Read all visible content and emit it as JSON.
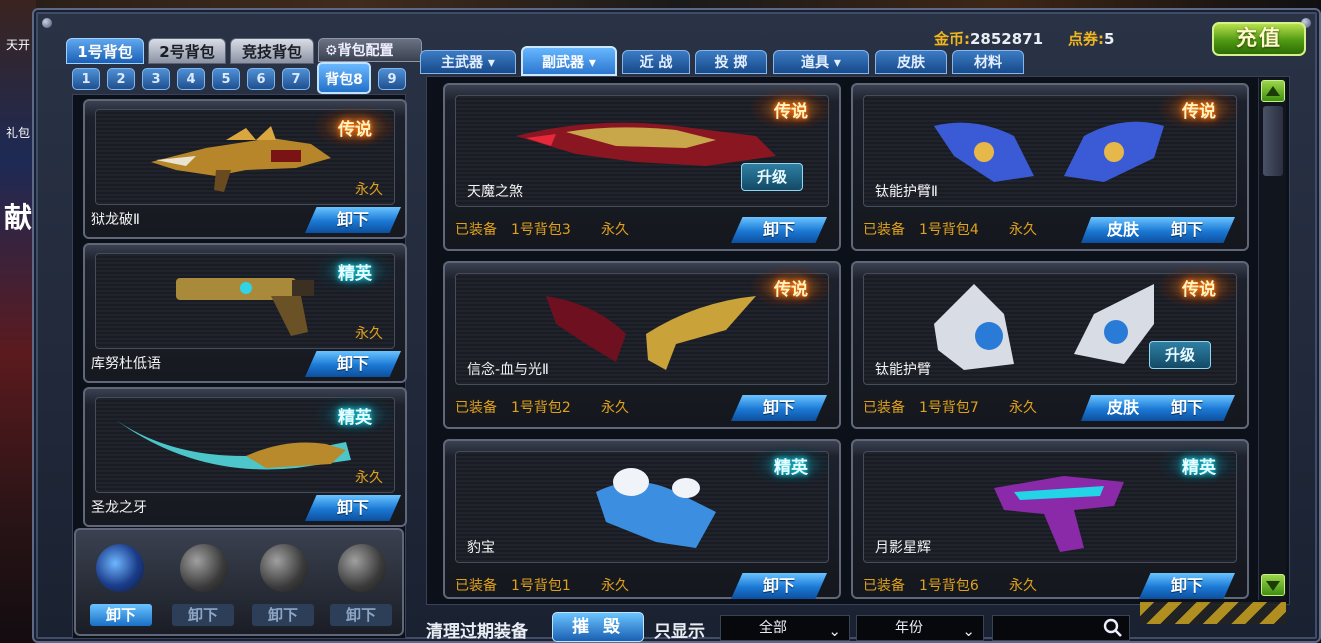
{
  "background": {
    "left_fragments": [
      "天开",
      "礼包",
      "献"
    ]
  },
  "header": {
    "gold_label": "金币:",
    "gold_value": "2852871",
    "points_label": "点券:",
    "points_value": "5",
    "recharge_label": "充值"
  },
  "bag_tabs": [
    {
      "label": "1号背包",
      "active": true
    },
    {
      "label": "2号背包",
      "active": false
    },
    {
      "label": "竞技背包",
      "active": false
    }
  ],
  "bag_config_label": "背包配置",
  "bag_numbers": [
    "1",
    "2",
    "3",
    "4",
    "5",
    "6",
    "7",
    "背包8",
    "9"
  ],
  "active_bag_number": "背包8",
  "equipped": [
    {
      "name": "狱龙破Ⅱ",
      "rarity": "传说",
      "duration": "永久",
      "button": "卸下"
    },
    {
      "name": "库努杜低语",
      "rarity": "精英",
      "duration": "永久",
      "button": "卸下"
    },
    {
      "name": "圣龙之牙",
      "rarity": "精英",
      "duration": "永久",
      "button": "卸下"
    }
  ],
  "grenade_slot": {
    "buttons": [
      "卸下",
      "卸下",
      "卸下",
      "卸下"
    ]
  },
  "weapon_tabs": [
    "主武器",
    "副武器",
    "近 战",
    "投 掷",
    "道具",
    "皮肤",
    "材料"
  ],
  "active_weapon_tab": "副武器",
  "items": [
    {
      "name": "天魔之煞",
      "rarity": "传说",
      "status": "已装备",
      "bag": "1号背包3",
      "duration": "永久",
      "upgrade": "升级",
      "skin": "",
      "button": "卸下"
    },
    {
      "name": "钛能护臂Ⅱ",
      "rarity": "传说",
      "status": "已装备",
      "bag": "1号背包4",
      "duration": "永久",
      "upgrade": "",
      "skin": "皮肤",
      "button": "卸下"
    },
    {
      "name": "信念-血与光Ⅱ",
      "rarity": "传说",
      "status": "已装备",
      "bag": "1号背包2",
      "duration": "永久",
      "upgrade": "",
      "skin": "",
      "button": "卸下"
    },
    {
      "name": "钛能护臂",
      "rarity": "传说",
      "status": "已装备",
      "bag": "1号背包7",
      "duration": "永久",
      "upgrade": "升级",
      "skin": "皮肤",
      "button": "卸下"
    },
    {
      "name": "豹宝",
      "rarity": "精英",
      "status": "已装备",
      "bag": "1号背包1",
      "duration": "永久",
      "upgrade": "",
      "skin": "",
      "button": "卸下"
    },
    {
      "name": "月影星辉",
      "rarity": "精英",
      "status": "已装备",
      "bag": "1号背包6",
      "duration": "永久",
      "upgrade": "",
      "skin": "",
      "button": "卸下"
    }
  ],
  "footer": {
    "clear_label": "清理过期装备",
    "destroy_label": "摧 毁",
    "filter_label": "只显示",
    "filter_all": "全部",
    "filter_year": "年份",
    "search_value": ""
  },
  "colors": {
    "legend": "#ff7a00",
    "elite": "#14c8e6",
    "gold_text": "#e0a11b",
    "accent_blue": "#1a78d4",
    "green_button": "#4f9a12"
  }
}
